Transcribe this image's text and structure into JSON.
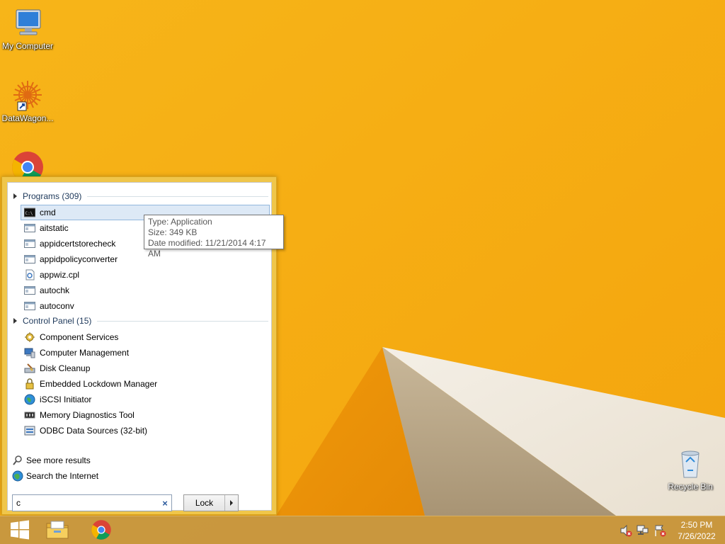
{
  "desktop": {
    "icons": [
      {
        "label": "My Computer",
        "icon": "computer-icon"
      },
      {
        "label": "DataWagon...",
        "icon": "datawagon-icon"
      },
      {
        "label": "Recycle Bin",
        "icon": "recycle-bin-icon"
      }
    ]
  },
  "start_menu": {
    "programs_header": "Programs (309)",
    "programs": [
      {
        "label": "cmd",
        "icon": "cmd-icon",
        "selected": true
      },
      {
        "label": "aitstatic",
        "icon": "app-icon"
      },
      {
        "label": "appidcertstorecheck",
        "icon": "app-icon"
      },
      {
        "label": "appidpolicyconverter",
        "icon": "app-icon"
      },
      {
        "label": "appwiz.cpl",
        "icon": "cpl-icon"
      },
      {
        "label": "autochk",
        "icon": "app-icon"
      },
      {
        "label": "autoconv",
        "icon": "app-icon"
      }
    ],
    "control_panel_header": "Control Panel (15)",
    "control_panel": [
      {
        "label": "Component Services",
        "icon": "component-services-icon"
      },
      {
        "label": "Computer Management",
        "icon": "computer-management-icon"
      },
      {
        "label": "Disk Cleanup",
        "icon": "disk-cleanup-icon"
      },
      {
        "label": "Embedded Lockdown Manager",
        "icon": "lock-icon"
      },
      {
        "label": "iSCSI Initiator",
        "icon": "globe-icon"
      },
      {
        "label": "Memory Diagnostics Tool",
        "icon": "memory-icon"
      },
      {
        "label": "ODBC Data Sources (32-bit)",
        "icon": "database-icon"
      }
    ],
    "see_more": "See more results",
    "search_internet": "Search the Internet",
    "search_value": "c",
    "lock_label": "Lock"
  },
  "tooltip": {
    "type": "Type: Application",
    "size": "Size: 349 KB",
    "modified": "Date modified: 11/21/2014 4:17 AM"
  },
  "taskbar": {
    "time": "2:50 PM",
    "date": "7/26/2022"
  }
}
